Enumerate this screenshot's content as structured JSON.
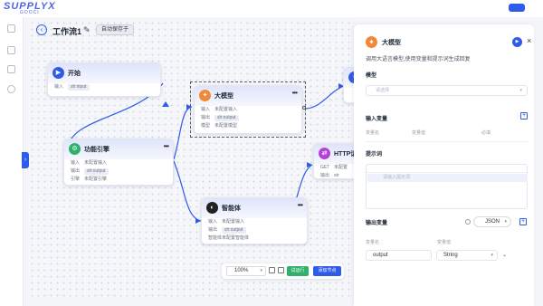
{
  "app": {
    "logo_text": "SUPPLYX",
    "logo_sub": "GOOCI"
  },
  "toolbar": {
    "back_icon": "chevron-left-icon",
    "title": "工作流1",
    "autosave_label": "自动保存于"
  },
  "nodes": {
    "start": {
      "title": "开始",
      "rows": [
        {
          "k": "输入",
          "v": "sh:input"
        }
      ]
    },
    "function": {
      "title": "功能引擎",
      "rows": [
        {
          "k": "输入",
          "v": "未配置输入"
        },
        {
          "k": "输出",
          "v": "sh:output"
        },
        {
          "k": "引擎",
          "v": "未配置引擎"
        }
      ]
    },
    "llm": {
      "title": "大模型",
      "rows": [
        {
          "k": "输入",
          "v": "未配置输入"
        },
        {
          "k": "输出",
          "v": "sh:output"
        },
        {
          "k": "模型",
          "v": "未配置模型"
        }
      ]
    },
    "agent": {
      "title": "智能体",
      "rows": [
        {
          "k": "输入",
          "v": "未配置输入"
        },
        {
          "k": "输出",
          "v": "sh:output"
        },
        {
          "k": "智能体",
          "v": "未配置智能体"
        }
      ]
    },
    "http": {
      "title": "HTTP请",
      "rows": [
        {
          "k": "GET",
          "v": "未配置"
        },
        {
          "k": "输出",
          "v": "str"
        }
      ]
    }
  },
  "bottom_tools": {
    "zoom": "100%",
    "run_label": "试运行",
    "add_label": "添加节点"
  },
  "panel": {
    "title": "大模型",
    "description": "调用大语言模型,使用变量和提示词生成回复",
    "model_label": "模型",
    "model_placeholder": "请选择",
    "input_vars_label": "输入变量",
    "input_cols": [
      "变量名",
      "变量值",
      "必填"
    ],
    "prompt_label": "提示词",
    "prompt_placeholder": "请输入提示词",
    "output_vars_label": "输出变量",
    "output_format": "JSON",
    "output_cols": [
      "变量名",
      "变量值"
    ],
    "output_row": {
      "name": "output",
      "type": "String"
    }
  },
  "colors": {
    "accent": "#2f5bea",
    "llm": "#f08a3a",
    "function": "#2fb06b",
    "http": "#b343d6",
    "start": "#2f5bea"
  }
}
